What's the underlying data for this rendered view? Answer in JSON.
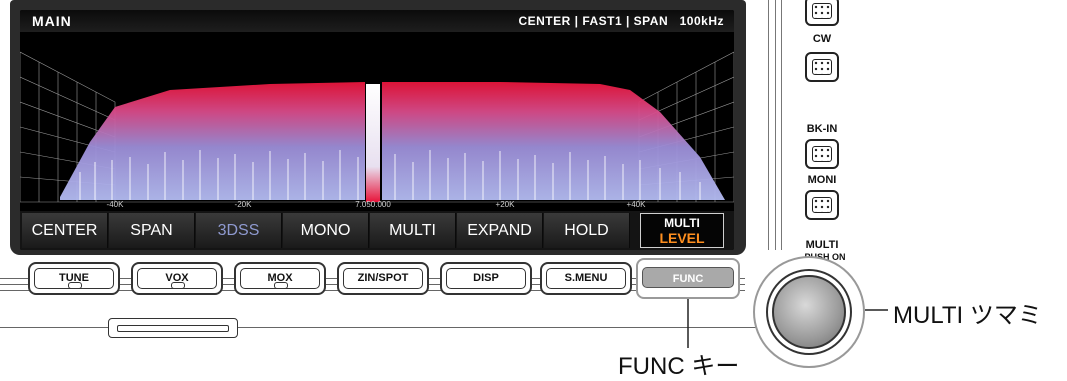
{
  "screen": {
    "status_main": "MAIN",
    "status_right": "CENTER | FAST1 | SPAN   100kHz",
    "freq_labels": [
      "-40K",
      "-20K",
      "7.050.000",
      "+20K",
      "+40K"
    ]
  },
  "softkeys": [
    {
      "label": "CENTER"
    },
    {
      "label": "SPAN"
    },
    {
      "label": "3DSS"
    },
    {
      "label": "MONO"
    },
    {
      "label": "MULTI"
    },
    {
      "label": "EXPAND"
    },
    {
      "label": "HOLD"
    }
  ],
  "softkey_active": {
    "line1": "MULTI",
    "line2": "LEVEL"
  },
  "hw_buttons": [
    {
      "label": "TUNE"
    },
    {
      "label": "VOX"
    },
    {
      "label": "MOX"
    },
    {
      "label": "ZIN/SPOT"
    },
    {
      "label": "DISP"
    },
    {
      "label": "S.MENU"
    },
    {
      "label": "FUNC"
    }
  ],
  "side": {
    "cw": "CW",
    "bkin": "BK-IN",
    "moni": "MONI",
    "multi": "MULTI",
    "push_on": "PUSH ON"
  },
  "callouts": {
    "multi_knob": "MULTI ツマミ",
    "func_key": "FUNC キー"
  },
  "colors": {
    "spectrum_peak": "#e8143a",
    "spectrum_base": "#9aa2e8",
    "active_accent": "#ff8f1f",
    "func_key": "#a9a9a9"
  }
}
